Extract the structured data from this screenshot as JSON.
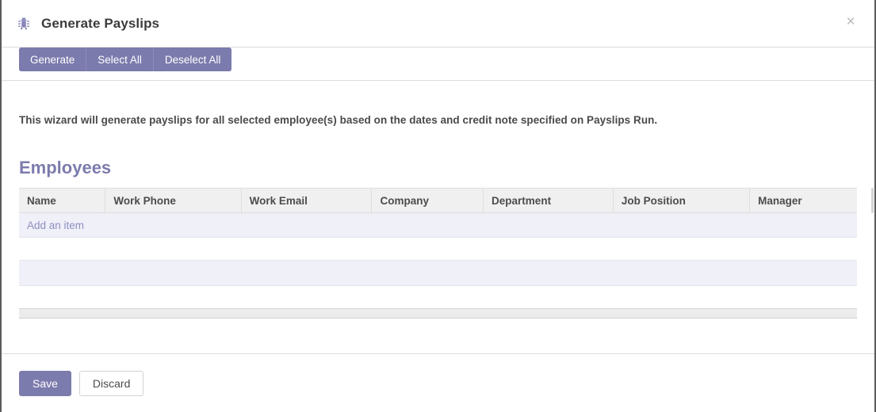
{
  "dialog": {
    "title": "Generate Payslips",
    "title_icon": "bug-icon",
    "close_label": "×",
    "accent_color": "#7c7bad"
  },
  "action_bar": {
    "buttons": [
      {
        "label": "Generate"
      },
      {
        "label": "Select All"
      },
      {
        "label": "Deselect All"
      }
    ]
  },
  "body": {
    "wizard_note": "This wizard will generate payslips for all selected employee(s) based on the dates and credit note specified on Payslips Run.",
    "section_title": "Employees"
  },
  "employees_table": {
    "columns": [
      "Name",
      "Work Phone",
      "Work Email",
      "Company",
      "Department",
      "Job Position",
      "Manager"
    ],
    "rows": [],
    "add_item_label": "Add an item"
  },
  "footer": {
    "save_label": "Save",
    "discard_label": "Discard"
  }
}
